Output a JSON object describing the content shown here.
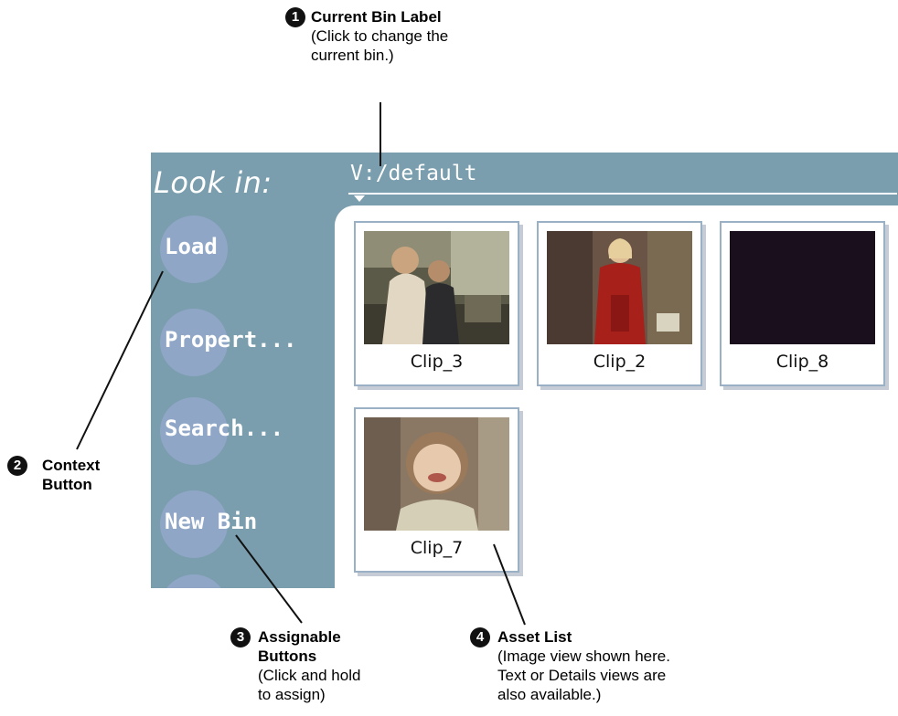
{
  "callouts": [
    {
      "num": "1",
      "title": "Current Bin Label",
      "desc": "(Click to change the current bin.)"
    },
    {
      "num": "2",
      "title": "Context Button",
      "desc": ""
    },
    {
      "num": "3",
      "title": "Assignable Buttons",
      "desc": "(Click and hold to assign)"
    },
    {
      "num": "4",
      "title": "Asset List",
      "desc": "(Image view shown here. Text or Details views are also available.)"
    }
  ],
  "panel": {
    "look_in_label": "Look in:",
    "current_bin": "V:/default",
    "side_buttons": [
      {
        "label": "Load"
      },
      {
        "label": "Propert..."
      },
      {
        "label": "Search..."
      },
      {
        "label": "New Bin"
      },
      {
        "label": ""
      }
    ]
  },
  "assets": [
    {
      "name": "Clip_3",
      "thumb": "car-interior-scene"
    },
    {
      "name": "Clip_2",
      "thumb": "woman-in-red-dress"
    },
    {
      "name": "Clip_8",
      "thumb": "black-frame"
    },
    {
      "name": "Clip_7",
      "thumb": "smiling-child"
    }
  ],
  "colors": {
    "panel_bg": "#7a9ead",
    "button_bg": "#8fa6c7",
    "asset_border": "#9ab0c4"
  }
}
